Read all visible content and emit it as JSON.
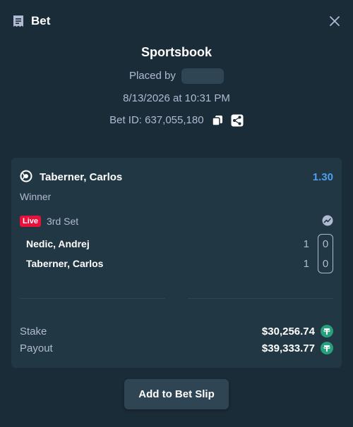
{
  "header": {
    "title": "Bet",
    "icon": "receipt-icon",
    "close_icon": "close-icon"
  },
  "info": {
    "sportsbook": "Sportsbook",
    "placed_by": "Placed by",
    "datetime": "8/13/2026 at 10:31 PM",
    "bet_id": "Bet ID: 637,055,180"
  },
  "selection": {
    "name": "Taberner, Carlos",
    "odds": "1.30",
    "market": "Winner",
    "live_label": "Live",
    "set_label": "3rd Set"
  },
  "scoreboard": [
    {
      "player": "Nedic, Andrej",
      "sets": "1",
      "current": "0"
    },
    {
      "player": "Taberner, Carlos",
      "sets": "1",
      "current": "0"
    }
  ],
  "summary": {
    "stake_label": "Stake",
    "stake_value": "$30,256.74",
    "payout_label": "Payout",
    "payout_value": "$39,333.77",
    "currency_icon": "tether-icon"
  },
  "actions": {
    "add_to_slip": "Add to Bet Slip"
  },
  "colors": {
    "background": "#1a2c38",
    "card": "#213743",
    "odds": "#4e9fef",
    "live": "#e9113c",
    "tether": "#26a17b",
    "muted_text": "#b1bad3"
  }
}
